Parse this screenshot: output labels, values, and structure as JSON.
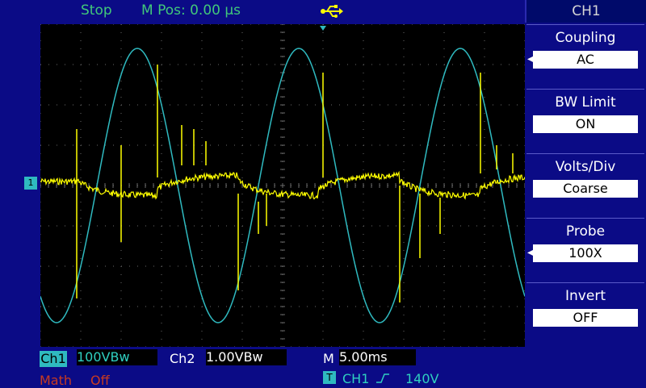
{
  "topbar": {
    "status": "Stop",
    "mpos_label": "M Pos:",
    "mpos_value": "0.00 µs",
    "usb_icon": "usb-icon"
  },
  "menu": {
    "title": "CH1",
    "items": [
      {
        "label": "Coupling",
        "value": "AC",
        "has_arrow": true
      },
      {
        "label": "BW Limit",
        "value": "ON",
        "has_arrow": false
      },
      {
        "label": "Volts/Div",
        "value": "Coarse",
        "has_arrow": false
      },
      {
        "label": "Probe",
        "value": "100X",
        "has_arrow": true
      },
      {
        "label": "Invert",
        "value": "OFF",
        "has_arrow": false
      }
    ]
  },
  "bottom": {
    "ch1_label": "Ch1",
    "ch1_scale": "100VBw",
    "ch2_label": "Ch2",
    "ch2_scale": "1.00VBw",
    "time_label": "M",
    "time_scale": "5.00ms",
    "math_label": "Math",
    "math_value": "Off",
    "trigger_badge": "T",
    "trigger_source": "CH1",
    "trigger_level": "140V"
  },
  "channel_marker": "1",
  "colors": {
    "background": "#0b0b86",
    "screen": "#000000",
    "ch1_trace": "#ffff00",
    "ch2_trace": "#2fbac0",
    "status_text": "#41c87a",
    "math_text": "#c83a20"
  }
}
